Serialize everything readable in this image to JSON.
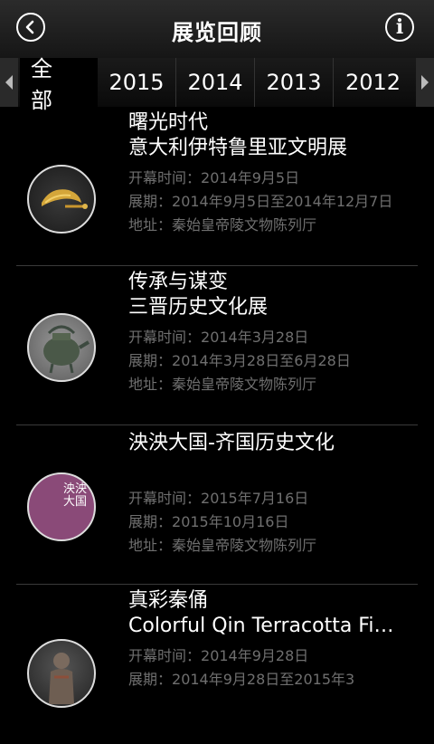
{
  "header": {
    "title": "展览回顾",
    "back_icon": "back-circle-icon",
    "info_icon": "info-circle-icon"
  },
  "tabs": [
    {
      "label": "全部",
      "active": true
    },
    {
      "label": "2015"
    },
    {
      "label": "2014"
    },
    {
      "label": "2013"
    },
    {
      "label": "2012"
    }
  ],
  "exhibitions": [
    {
      "subtitle": "曙光时代",
      "title": "意大利伊特鲁里亚文明展",
      "open_label": "开幕时间：",
      "open_date": "2014年9月5日",
      "period_label": "展期：",
      "period": "2014年9月5日至2014年12月7日",
      "address_label": "地址：",
      "address": "秦始皇帝陵文物陈列厅",
      "thumb_icon": "gold-artifact-thumbnail"
    },
    {
      "subtitle": "传承与谋变",
      "title": "三晋历史文化展",
      "open_label": "开幕时间：",
      "open_date": "2014年3月28日",
      "period_label": "展期：",
      "period": "2014年3月28日至6月28日",
      "address_label": "地址：",
      "address": "秦始皇帝陵文物陈列厅",
      "thumb_icon": "bronze-vessel-thumbnail"
    },
    {
      "subtitle": "泱泱大国-齐国历史文化",
      "title": "",
      "open_label": "开幕时间：",
      "open_date": "2015年7月16日",
      "period_label": "展期：",
      "period": "2015年10月16日",
      "address_label": "地址：",
      "address": "秦始皇帝陵文物陈列厅",
      "thumb_icon": "purple-poster-thumbnail",
      "thumb_text": "泱泱大国"
    },
    {
      "subtitle": "真彩秦俑",
      "title": "Colorful Qin Terracotta Fi…",
      "open_label": "开幕时间：",
      "open_date": "2014年9月28日",
      "period_label": "展期：",
      "period": "2014年9月28日至2015年3",
      "address_label": "",
      "address": "",
      "thumb_icon": "terracotta-figure-thumbnail"
    }
  ]
}
